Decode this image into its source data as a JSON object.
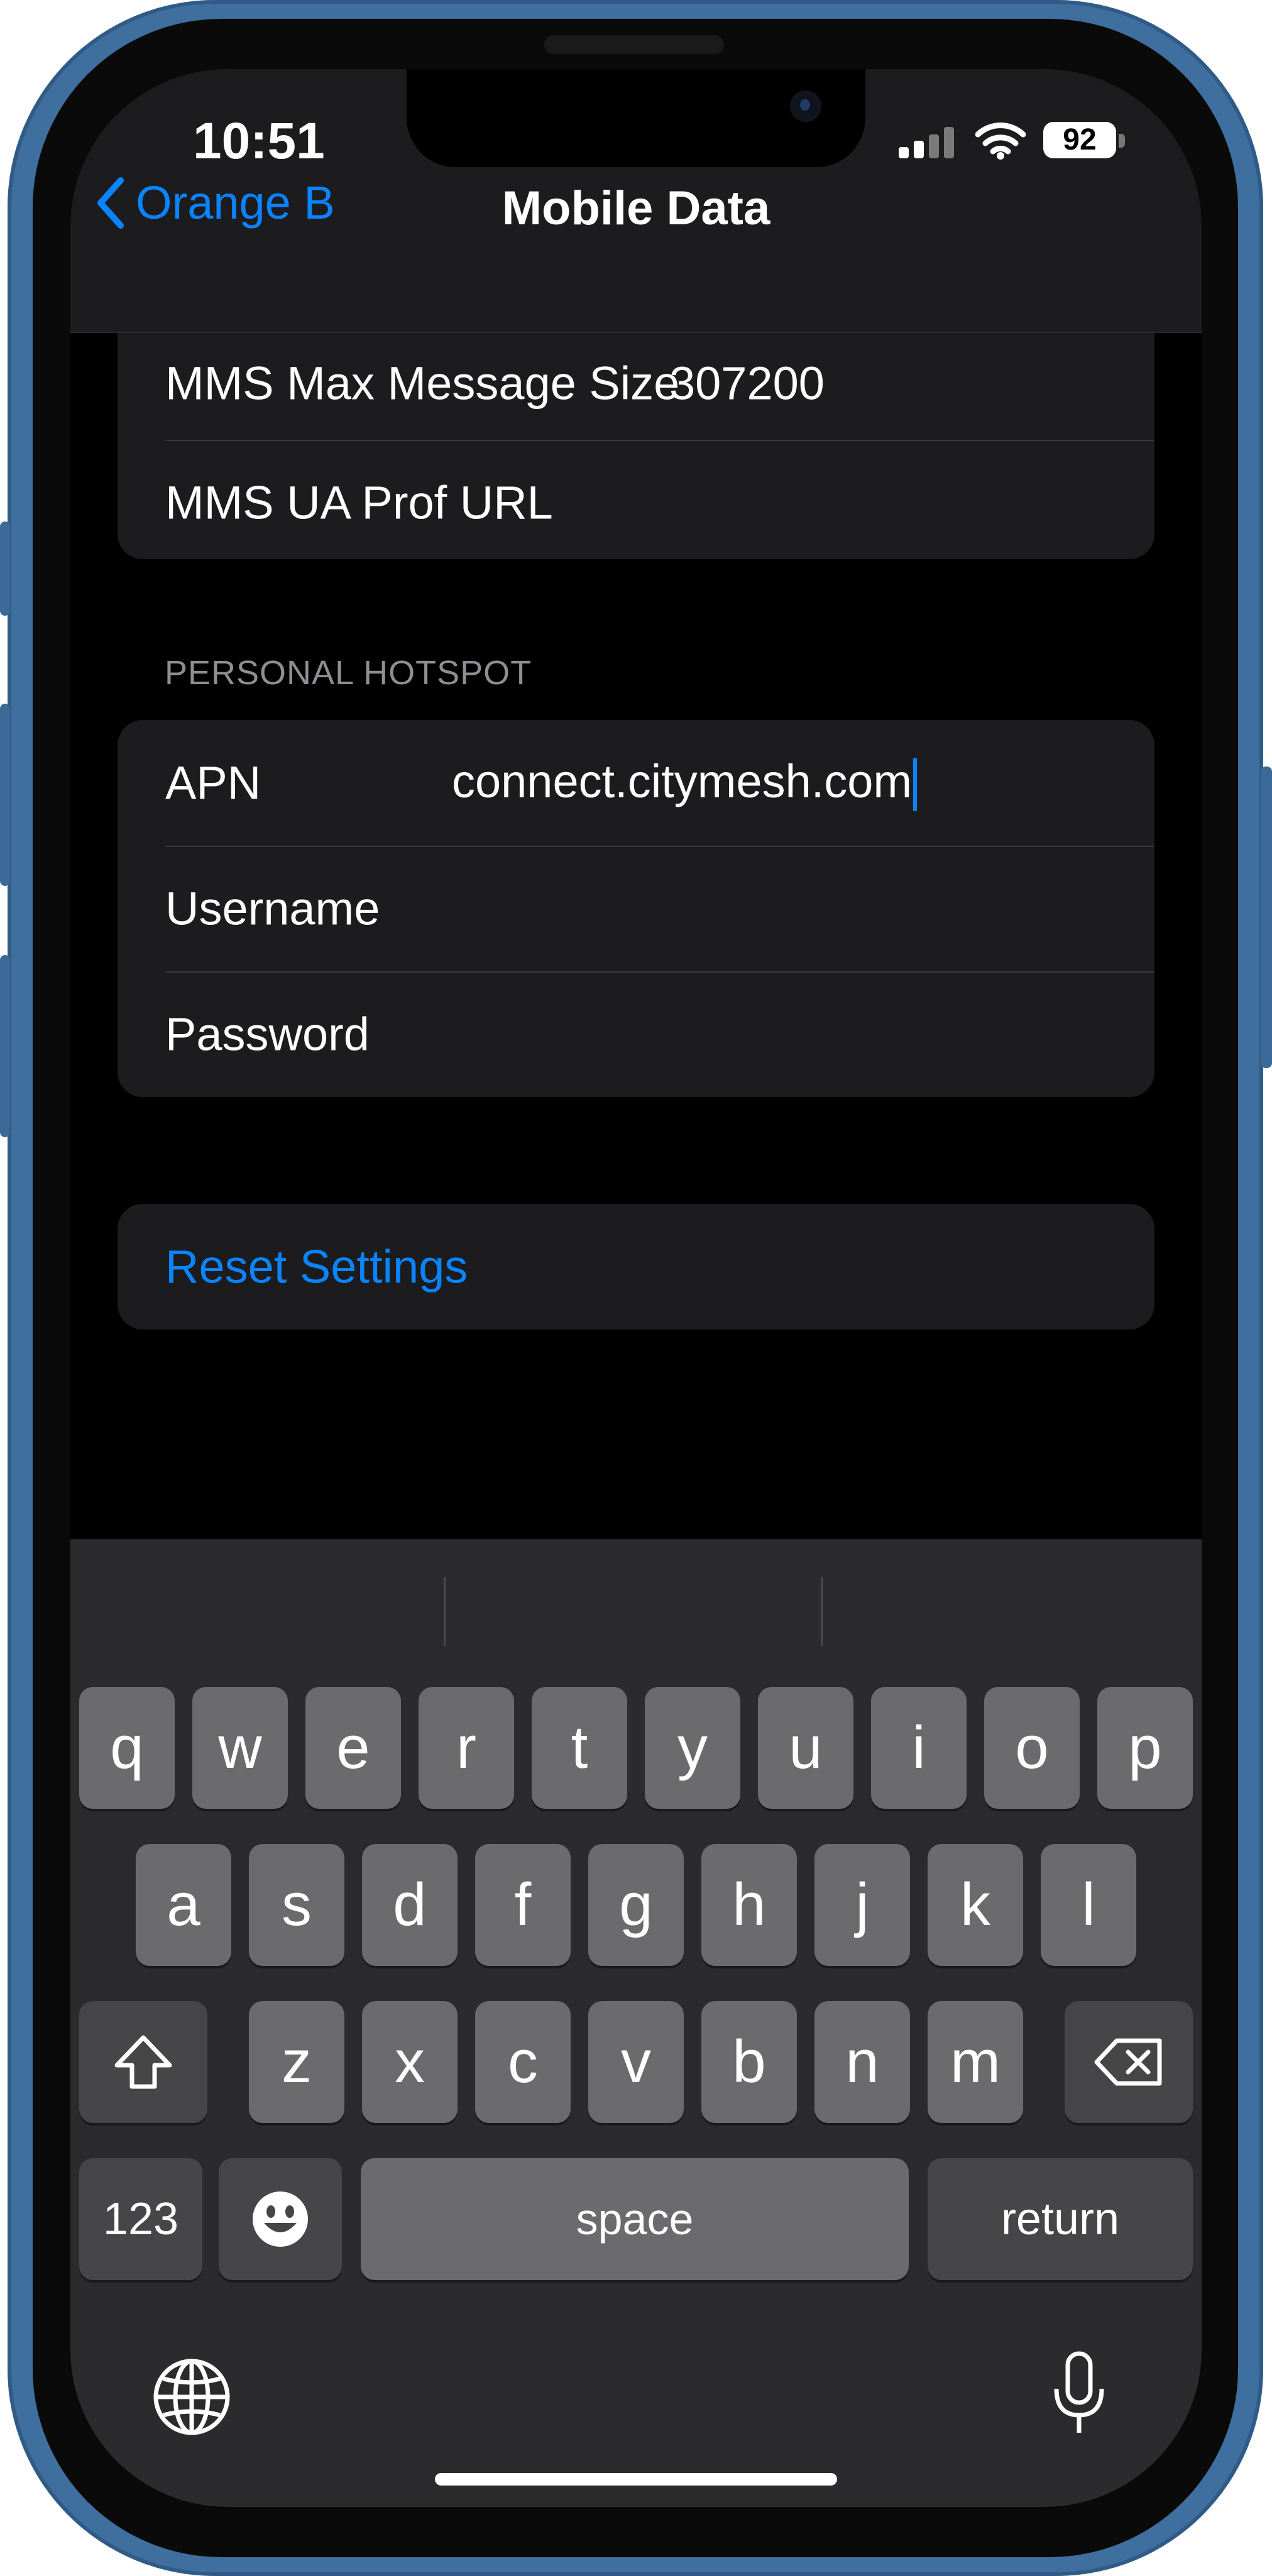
{
  "status_bar": {
    "time": "10:51",
    "battery": "92"
  },
  "nav": {
    "back_label": "Orange B",
    "title": "Mobile Data"
  },
  "mms_rows": [
    {
      "label": "MMS Max Message Size",
      "value": "307200"
    },
    {
      "label": "MMS UA Prof URL",
      "value": ""
    }
  ],
  "hotspot": {
    "header": "PERSONAL HOTSPOT",
    "apn": {
      "label": "APN",
      "value": "connect.citymesh.com"
    },
    "username": {
      "label": "Username",
      "value": ""
    },
    "password": {
      "label": "Password",
      "value": ""
    }
  },
  "reset_label": "Reset Settings",
  "keyboard": {
    "row1": [
      "q",
      "w",
      "e",
      "r",
      "t",
      "y",
      "u",
      "i",
      "o",
      "p"
    ],
    "row2": [
      "a",
      "s",
      "d",
      "f",
      "g",
      "h",
      "j",
      "k",
      "l"
    ],
    "row3": [
      "z",
      "x",
      "c",
      "v",
      "b",
      "n",
      "m"
    ],
    "numbers": "123",
    "space": "space",
    "return": "return"
  },
  "colors": {
    "accent": "#0a84ff",
    "cell_bg": "#1c1c1e",
    "frame": "#3f6f9e"
  }
}
